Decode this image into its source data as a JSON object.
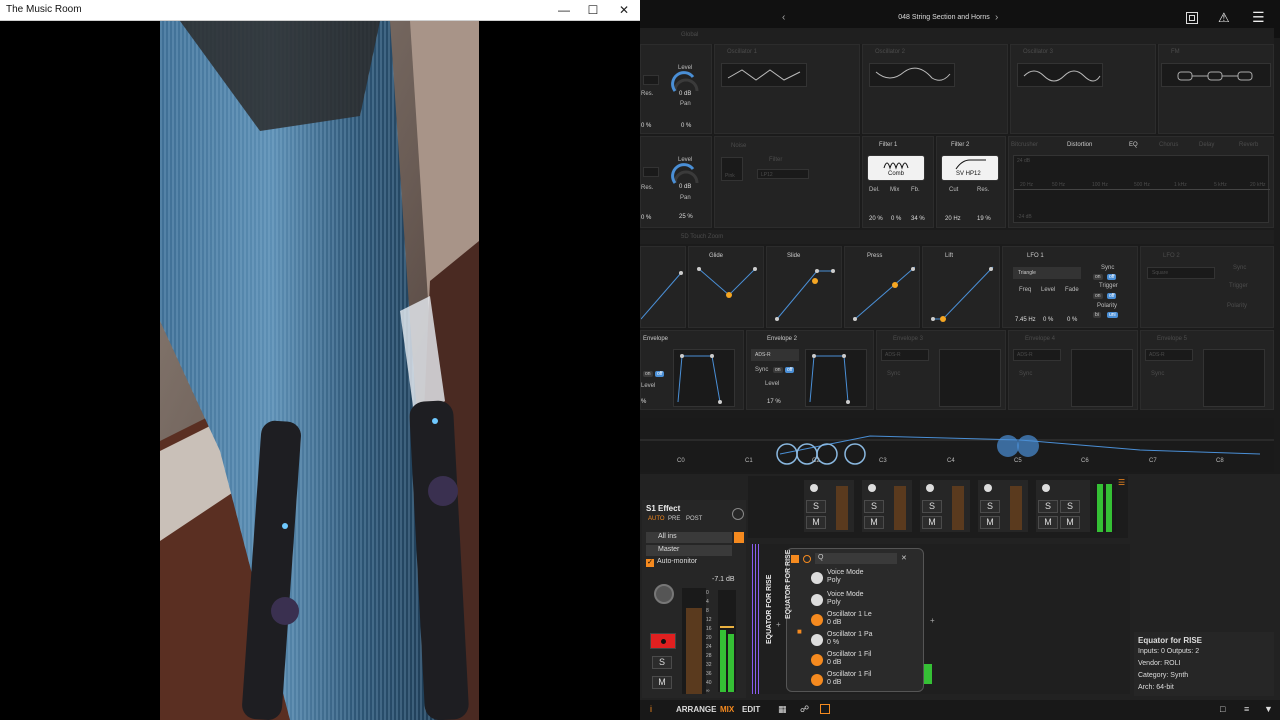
{
  "window": {
    "title": "The Music Room",
    "min_icon": "minimize-icon",
    "max_icon": "maximize-icon",
    "close_icon": "close-icon"
  },
  "preset": {
    "name": "048 String Section and Horns",
    "prev": "‹",
    "next": "›"
  },
  "synth": {
    "global": "Global",
    "osc1": "Oscillator 1",
    "osc2": "Oscillator 2",
    "osc3": "Oscillator 3",
    "fm": "FM",
    "level_label": "Level",
    "pan_label": "Pan",
    "res_label": "Res.",
    "lvl1": "0 dB",
    "pan1": "0 %",
    "res1": "0 %",
    "lvl2": "0 dB",
    "pan2": "25 %",
    "res2": "0 %",
    "noise": "Noise",
    "noise_type": "Pink",
    "noise_filter": "Filter",
    "noise_filter_type": "LP12",
    "filter1": "Filter 1",
    "filter1_type": "Comb",
    "del_label": "Del.",
    "mix_label": "Mix",
    "fb_label": "Fb.",
    "f1_del": "20 %",
    "f1_mix": "0 %",
    "f1_fb": "34 %",
    "filter2": "Filter 2",
    "filter2_type": "SV HP12",
    "cut_label": "Cut",
    "f2_cut": "20 Hz",
    "f2_res": "19 %",
    "fx_tabs": [
      "Bitcrusher",
      "Distortion",
      "EQ",
      "Chorus",
      "Delay",
      "Reverb"
    ],
    "eq_top": "24 dB",
    "eq_bottom": "-24 dB",
    "eq_freqs": [
      "20 Hz",
      "50 Hz",
      "100 Hz",
      "500 Hz",
      "1 kHz",
      "5 kHz",
      "20 kHz"
    ],
    "touch": "5D Touch Zoom",
    "mods": [
      "Glide",
      "Slide",
      "Press",
      "Lift"
    ],
    "lfo1": "LFO 1",
    "lfo1_shape": "Triangle",
    "sync_label": "Sync",
    "trigger_label": "Trigger",
    "polarity_label": "Polarity",
    "freq_label": "Freq",
    "fade_label": "Fade",
    "lfo_freq": "7.45 Hz",
    "lfo_level": "0 %",
    "lfo_fade": "0 %",
    "on_label": "on",
    "off_label": "off",
    "bi_label": "bi",
    "uni_label": "uni",
    "lfo2": "LFO 2",
    "lfo2_shape": "Square",
    "env1": "Envelope",
    "env2": "Envelope 2",
    "env3": "Envelope 3",
    "env4": "Envelope 4",
    "env5": "Envelope 5",
    "env_mode": "ADS-R",
    "env1_level": "Level",
    "env1_val": "%",
    "env2_level": "17 %",
    "keys": [
      "C0",
      "C1",
      "C2",
      "C3",
      "C4",
      "C5",
      "C6",
      "C7",
      "C8"
    ]
  },
  "inspector": {
    "title": "S1 Effect",
    "auto": "AUTO",
    "pre": "PRE",
    "post": "POST",
    "input": "All ins",
    "output": "Master",
    "monitor": "Auto-monitor",
    "gain": "-7.1 dB",
    "scale": [
      "0",
      "4",
      "8",
      "12",
      "16",
      "20",
      "24",
      "28",
      "32",
      "36",
      "40",
      "∞"
    ],
    "solo": "S",
    "mute": "M"
  },
  "mixer": {
    "s": "S",
    "m": "M"
  },
  "device": {
    "name": "EQUATOR FOR RISE",
    "search": "Q",
    "params": [
      {
        "name": "Voice Mode",
        "value": "Poly"
      },
      {
        "name": "Voice Mode",
        "value": "Poly"
      },
      {
        "name": "Oscillator 1 Le",
        "value": "0 dB"
      },
      {
        "name": "Oscillator 1 Pa",
        "value": "0 %"
      },
      {
        "name": "Oscillator 1 Fil",
        "value": "0 dB"
      },
      {
        "name": "Oscillator 1 Fil",
        "value": "0 dB"
      }
    ]
  },
  "info": {
    "title": "Equator for RISE",
    "io": "Inputs: 0   Outputs: 2",
    "vendor": "Vendor: ROLI",
    "category": "Category: Synth",
    "arch": "Arch: 64-bit"
  },
  "bottombar": {
    "arrange": "ARRANGE",
    "mix": "MIX",
    "edit": "EDIT"
  },
  "colors": {
    "accent": "#f58a1f",
    "blue": "#4a8fd6",
    "record": "#e02020",
    "meter": "#35c035"
  }
}
